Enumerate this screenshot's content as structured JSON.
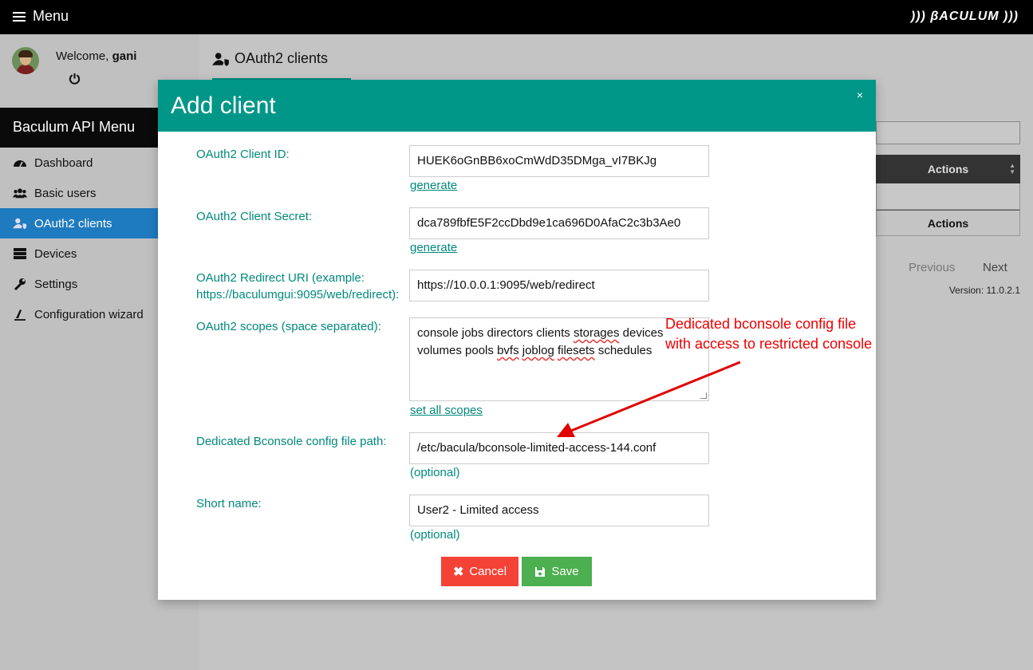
{
  "topbar": {
    "menu_label": "Menu",
    "logo_text": "))) βACULUM )))"
  },
  "sidebar": {
    "welcome_prefix": "Welcome",
    "username": "gani",
    "title": "Baculum API Menu",
    "items": [
      {
        "label": "Dashboard",
        "icon": "tachometer-icon",
        "active": false
      },
      {
        "label": "Basic users",
        "icon": "users-icon",
        "active": false
      },
      {
        "label": "OAuth2 clients",
        "icon": "user-shield-icon",
        "active": true
      },
      {
        "label": "Devices",
        "icon": "database-icon",
        "active": false
      },
      {
        "label": "Settings",
        "icon": "wrench-icon",
        "active": false
      },
      {
        "label": "Configuration wizard",
        "icon": "magic-icon",
        "active": false
      }
    ]
  },
  "main": {
    "tab_label": "OAuth2 clients",
    "table_header": "Actions",
    "table_footer": "Actions",
    "pagination": {
      "previous": "Previous",
      "next": "Next"
    },
    "version": "Version: 11.0.2.1"
  },
  "modal": {
    "title": "Add client",
    "close": "×",
    "fields": {
      "client_id": {
        "label": "OAuth2 Client ID:",
        "value": "HUEK6oGnBB6xoCmWdD35DMga_vI7BKJg",
        "link": "generate"
      },
      "client_secret": {
        "label": "OAuth2 Client Secret:",
        "value": "dca789fbfE5F2ccDbd9e1ca696D0AfaC2c3b3Ae0",
        "link": "generate"
      },
      "redirect_uri": {
        "label_line1": "OAuth2 Redirect URI (example:",
        "label_line2": "https://baculumgui:9095/web/redirect):",
        "value": "https://10.0.0.1:9095/web/redirect"
      },
      "scopes": {
        "label": "OAuth2 scopes (space separated):",
        "line1_a": "console jobs directors clients ",
        "line1_b": "storages",
        "line1_c": " devices",
        "line2_a": "volumes pools ",
        "line2_b": "bvfs",
        "line2_c": " ",
        "line2_d": "joblog",
        "line2_e": " ",
        "line2_f": "filesets",
        "line2_g": " schedules",
        "link": "set all scopes"
      },
      "bconsole": {
        "label": "Dedicated Bconsole config file path:",
        "value": "/etc/bacula/bconsole-limited-access-144.conf",
        "hint": "(optional)"
      },
      "short_name": {
        "label": "Short name:",
        "value": "User2 - Limited access",
        "hint": "(optional)"
      }
    },
    "buttons": {
      "cancel": "Cancel",
      "save": "Save"
    }
  },
  "annotation": {
    "line1": "Dedicated bconsole config file",
    "line2": "with access to restricted console",
    "color": "#e00000"
  }
}
